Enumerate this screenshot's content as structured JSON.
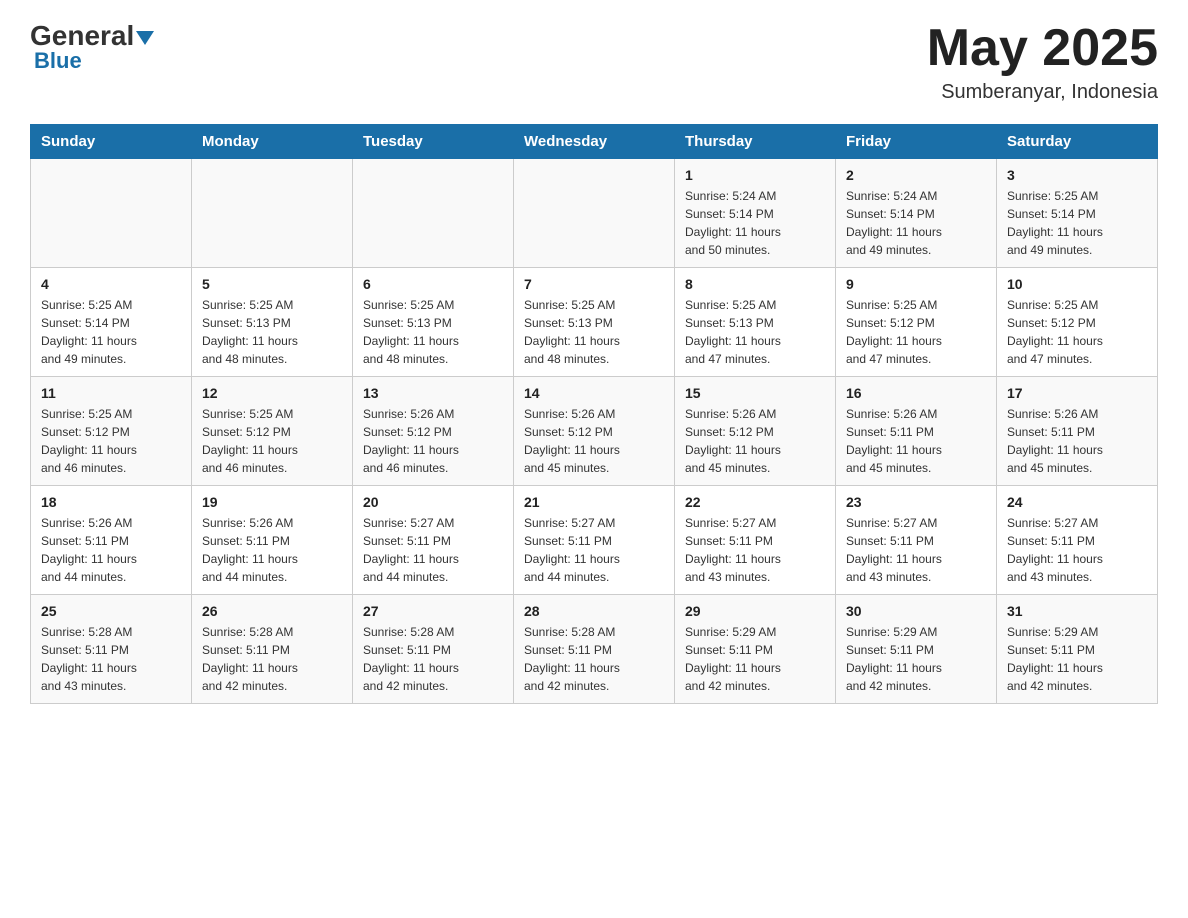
{
  "logo": {
    "general": "General",
    "blue": "Blue"
  },
  "header": {
    "month_year": "May 2025",
    "location": "Sumberanyar, Indonesia"
  },
  "days_of_week": [
    "Sunday",
    "Monday",
    "Tuesday",
    "Wednesday",
    "Thursday",
    "Friday",
    "Saturday"
  ],
  "weeks": [
    {
      "days": [
        {
          "num": "",
          "info": ""
        },
        {
          "num": "",
          "info": ""
        },
        {
          "num": "",
          "info": ""
        },
        {
          "num": "",
          "info": ""
        },
        {
          "num": "1",
          "info": "Sunrise: 5:24 AM\nSunset: 5:14 PM\nDaylight: 11 hours\nand 50 minutes."
        },
        {
          "num": "2",
          "info": "Sunrise: 5:24 AM\nSunset: 5:14 PM\nDaylight: 11 hours\nand 49 minutes."
        },
        {
          "num": "3",
          "info": "Sunrise: 5:25 AM\nSunset: 5:14 PM\nDaylight: 11 hours\nand 49 minutes."
        }
      ]
    },
    {
      "days": [
        {
          "num": "4",
          "info": "Sunrise: 5:25 AM\nSunset: 5:14 PM\nDaylight: 11 hours\nand 49 minutes."
        },
        {
          "num": "5",
          "info": "Sunrise: 5:25 AM\nSunset: 5:13 PM\nDaylight: 11 hours\nand 48 minutes."
        },
        {
          "num": "6",
          "info": "Sunrise: 5:25 AM\nSunset: 5:13 PM\nDaylight: 11 hours\nand 48 minutes."
        },
        {
          "num": "7",
          "info": "Sunrise: 5:25 AM\nSunset: 5:13 PM\nDaylight: 11 hours\nand 48 minutes."
        },
        {
          "num": "8",
          "info": "Sunrise: 5:25 AM\nSunset: 5:13 PM\nDaylight: 11 hours\nand 47 minutes."
        },
        {
          "num": "9",
          "info": "Sunrise: 5:25 AM\nSunset: 5:12 PM\nDaylight: 11 hours\nand 47 minutes."
        },
        {
          "num": "10",
          "info": "Sunrise: 5:25 AM\nSunset: 5:12 PM\nDaylight: 11 hours\nand 47 minutes."
        }
      ]
    },
    {
      "days": [
        {
          "num": "11",
          "info": "Sunrise: 5:25 AM\nSunset: 5:12 PM\nDaylight: 11 hours\nand 46 minutes."
        },
        {
          "num": "12",
          "info": "Sunrise: 5:25 AM\nSunset: 5:12 PM\nDaylight: 11 hours\nand 46 minutes."
        },
        {
          "num": "13",
          "info": "Sunrise: 5:26 AM\nSunset: 5:12 PM\nDaylight: 11 hours\nand 46 minutes."
        },
        {
          "num": "14",
          "info": "Sunrise: 5:26 AM\nSunset: 5:12 PM\nDaylight: 11 hours\nand 45 minutes."
        },
        {
          "num": "15",
          "info": "Sunrise: 5:26 AM\nSunset: 5:12 PM\nDaylight: 11 hours\nand 45 minutes."
        },
        {
          "num": "16",
          "info": "Sunrise: 5:26 AM\nSunset: 5:11 PM\nDaylight: 11 hours\nand 45 minutes."
        },
        {
          "num": "17",
          "info": "Sunrise: 5:26 AM\nSunset: 5:11 PM\nDaylight: 11 hours\nand 45 minutes."
        }
      ]
    },
    {
      "days": [
        {
          "num": "18",
          "info": "Sunrise: 5:26 AM\nSunset: 5:11 PM\nDaylight: 11 hours\nand 44 minutes."
        },
        {
          "num": "19",
          "info": "Sunrise: 5:26 AM\nSunset: 5:11 PM\nDaylight: 11 hours\nand 44 minutes."
        },
        {
          "num": "20",
          "info": "Sunrise: 5:27 AM\nSunset: 5:11 PM\nDaylight: 11 hours\nand 44 minutes."
        },
        {
          "num": "21",
          "info": "Sunrise: 5:27 AM\nSunset: 5:11 PM\nDaylight: 11 hours\nand 44 minutes."
        },
        {
          "num": "22",
          "info": "Sunrise: 5:27 AM\nSunset: 5:11 PM\nDaylight: 11 hours\nand 43 minutes."
        },
        {
          "num": "23",
          "info": "Sunrise: 5:27 AM\nSunset: 5:11 PM\nDaylight: 11 hours\nand 43 minutes."
        },
        {
          "num": "24",
          "info": "Sunrise: 5:27 AM\nSunset: 5:11 PM\nDaylight: 11 hours\nand 43 minutes."
        }
      ]
    },
    {
      "days": [
        {
          "num": "25",
          "info": "Sunrise: 5:28 AM\nSunset: 5:11 PM\nDaylight: 11 hours\nand 43 minutes."
        },
        {
          "num": "26",
          "info": "Sunrise: 5:28 AM\nSunset: 5:11 PM\nDaylight: 11 hours\nand 42 minutes."
        },
        {
          "num": "27",
          "info": "Sunrise: 5:28 AM\nSunset: 5:11 PM\nDaylight: 11 hours\nand 42 minutes."
        },
        {
          "num": "28",
          "info": "Sunrise: 5:28 AM\nSunset: 5:11 PM\nDaylight: 11 hours\nand 42 minutes."
        },
        {
          "num": "29",
          "info": "Sunrise: 5:29 AM\nSunset: 5:11 PM\nDaylight: 11 hours\nand 42 minutes."
        },
        {
          "num": "30",
          "info": "Sunrise: 5:29 AM\nSunset: 5:11 PM\nDaylight: 11 hours\nand 42 minutes."
        },
        {
          "num": "31",
          "info": "Sunrise: 5:29 AM\nSunset: 5:11 PM\nDaylight: 11 hours\nand 42 minutes."
        }
      ]
    }
  ]
}
